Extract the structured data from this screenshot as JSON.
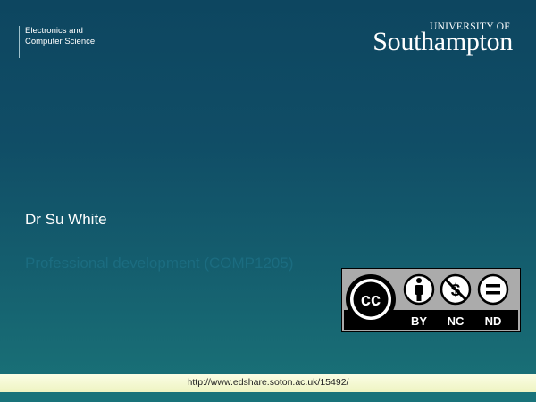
{
  "department": {
    "line1": "Electronics and",
    "line2": "Computer Science"
  },
  "logo": {
    "university_of": "UNIVERSITY OF",
    "name": "Southampton"
  },
  "author": "Dr Su White",
  "course": "Professional development (COMP1205)",
  "license": {
    "badge": [
      "cc",
      "by",
      "nc",
      "nd"
    ],
    "labels": [
      "BY",
      "NC",
      "ND"
    ]
  },
  "footer": {
    "url": "http://www.edshare.soton.ac.uk/15492/"
  },
  "colors": {
    "background_top": "#0d4660",
    "background_bottom": "#1a7378",
    "footer_band": "#eef4c2",
    "course_text": "#1b6c80"
  }
}
